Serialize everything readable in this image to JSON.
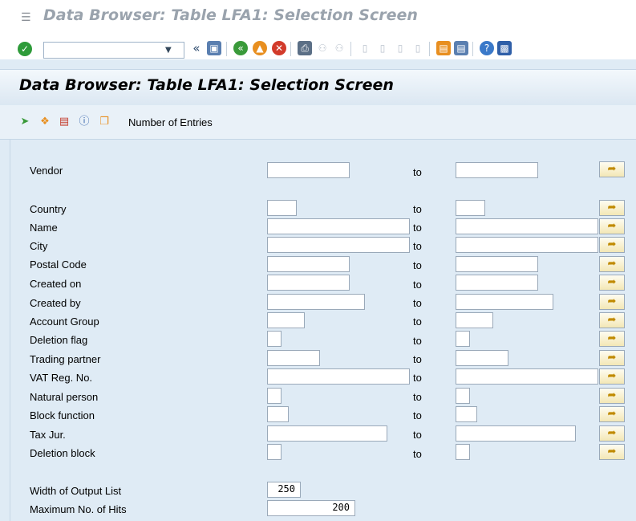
{
  "window_title": "Data Browser: Table LFA1: Selection Screen",
  "screen_title": "Data Browser: Table LFA1: Selection Screen",
  "command_field": {
    "value": ""
  },
  "toolbar_icons": [
    "check-icon",
    "back-icon",
    "save-icon",
    "back-green-icon",
    "exit-icon",
    "cancel-icon",
    "print-icon",
    "find-icon",
    "find-next-icon",
    "first-page-icon",
    "prev-page-icon",
    "next-page-icon",
    "last-page-icon",
    "create-session-icon",
    "generate-shortcut-icon",
    "help-icon",
    "customize-icon"
  ],
  "app_toolbar": {
    "number_entries_label": "Number of Entries"
  },
  "to_label": "to",
  "fields": {
    "vendor": "Vendor",
    "country": "Country",
    "name": "Name",
    "city": "City",
    "postal_code": "Postal Code",
    "created_on": "Created on",
    "created_by": "Created by",
    "account_group": "Account Group",
    "deletion_flag": "Deletion flag",
    "trading_partner": "Trading partner",
    "vat_reg_no": "VAT Reg. No.",
    "natural_person": "Natural person",
    "block_function": "Block function",
    "tax_jur": "Tax Jur.",
    "deletion_block": "Deletion block"
  },
  "output": {
    "width_label": "Width of Output List",
    "width_value": "250",
    "max_hits_label": "Maximum No. of Hits",
    "max_hits_value": "200"
  },
  "colors": {
    "header_bg": "#dbe7f2",
    "content_bg": "#dfebf5",
    "title_grey": "#9aa3ad"
  }
}
